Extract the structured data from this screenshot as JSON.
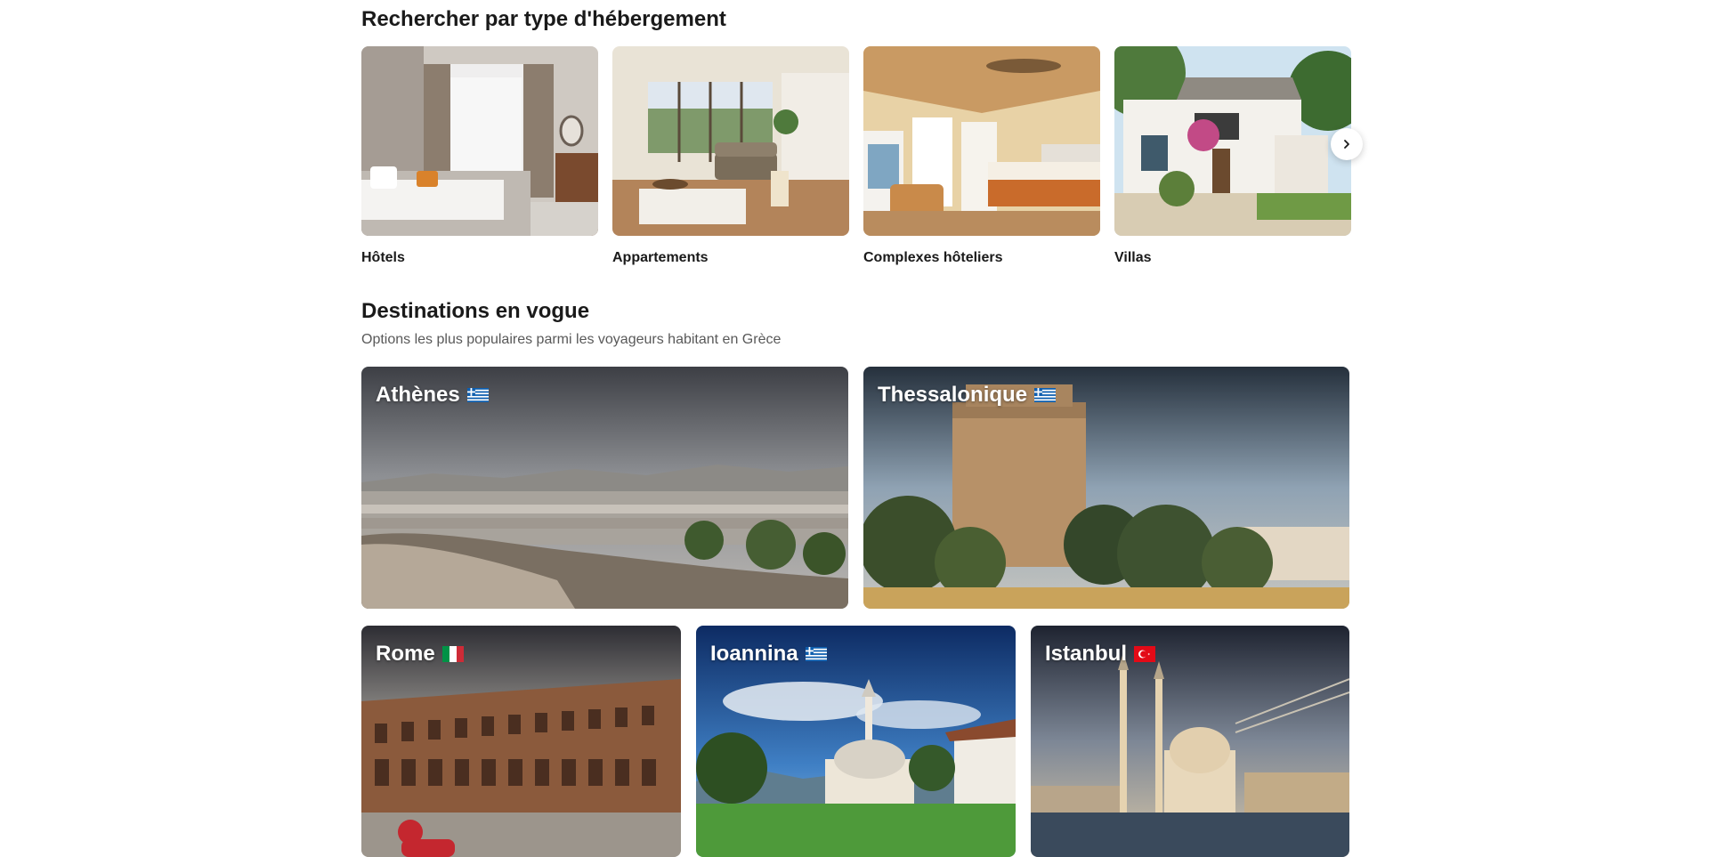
{
  "property_types": {
    "title": "Rechercher par type d'hébergement",
    "items": [
      {
        "label": "Hôtels"
      },
      {
        "label": "Appartements"
      },
      {
        "label": "Complexes hôteliers"
      },
      {
        "label": "Villas"
      }
    ]
  },
  "trending": {
    "title": "Destinations en vogue",
    "subtitle": "Options les plus populaires parmi les voyageurs habitant en Grèce",
    "destinations": [
      {
        "name": "Athènes",
        "flag": "greece-flag"
      },
      {
        "name": "Thessalonique",
        "flag": "greece-flag"
      },
      {
        "name": "Rome",
        "flag": "italy-flag"
      },
      {
        "name": "Ioannina",
        "flag": "greece-flag"
      },
      {
        "name": "Istanbul",
        "flag": "turkey-flag"
      }
    ]
  },
  "colors": {
    "text": "#1a1a1a",
    "subtext": "#595959",
    "greece_blue": "#0d5eaf",
    "italy_green": "#009246",
    "italy_red": "#ce2b37",
    "turkey_red": "#e30a17"
  }
}
